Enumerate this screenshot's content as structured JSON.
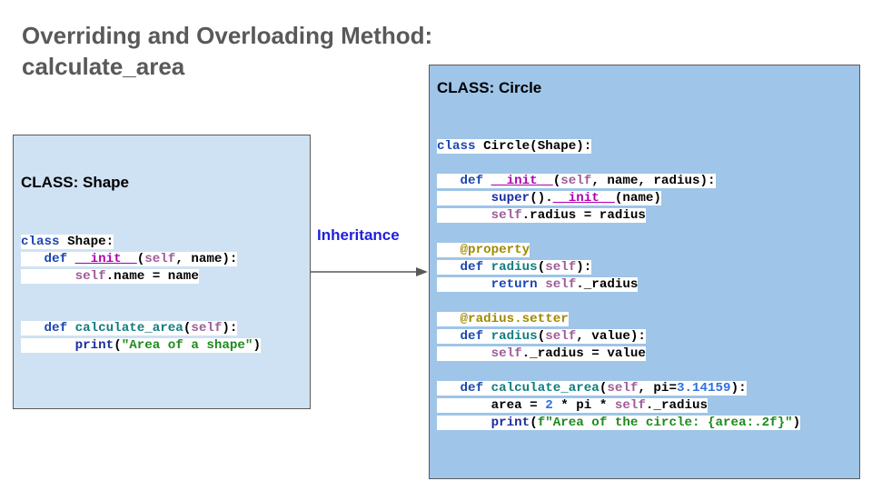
{
  "title": {
    "line1": "Overriding and Overloading Method:",
    "line2": "calculate_area"
  },
  "relationship": {
    "label": "Inheritance",
    "from": "CLASS: Shape",
    "to": "CLASS: Circle"
  },
  "shape_class": {
    "heading": "CLASS: Shape",
    "code": {
      "l1_kw": "class",
      "l1_rest": " Shape:",
      "l2_kw": "def",
      "l2_magic": "__init__",
      "l2_open": "(",
      "l2_self": "self",
      "l2_rest": ", name):",
      "l3_self": "self",
      "l3_rest": ".name = name",
      "l4_kw": "def",
      "l4_fn": "calculate_area",
      "l4_open": "(",
      "l4_self": "self",
      "l4_rest": "):",
      "l5_fn": "print",
      "l5_open": "(",
      "l5_str": "\"Area of a shape\"",
      "l5_close": ")"
    }
  },
  "circle_class": {
    "heading": "CLASS: Circle",
    "code": {
      "l1_kw": "class",
      "l1_rest": " Circle(Shape):",
      "l2_kw": "def",
      "l2_magic": "__init__",
      "l2_open": "(",
      "l2_self": "self",
      "l2_rest": ", name, radius):",
      "l3_fn": "super",
      "l3_mid": "().",
      "l3_magic": "__init__",
      "l3_rest": "(name)",
      "l4_self": "self",
      "l4_rest": ".radius = radius",
      "l5_dec": "@property",
      "l6_kw": "def",
      "l6_fn": "radius",
      "l6_open": "(",
      "l6_self": "self",
      "l6_rest": "):",
      "l7_kw": "return",
      "l7_self": "self",
      "l7_rest": "._radius",
      "l8_dec": "@radius.setter",
      "l9_kw": "def",
      "l9_fn": "radius",
      "l9_open": "(",
      "l9_self": "self",
      "l9_rest": ", value):",
      "l10_self": "self",
      "l10_rest": "._radius = value",
      "l11_kw": "def",
      "l11_fn": "calculate_area",
      "l11_open": "(",
      "l11_self": "self",
      "l11_mid": ", pi=",
      "l11_num": "3.14159",
      "l11_rest": "):",
      "l12_a": "area = ",
      "l12_num": "2",
      "l12_b": " * pi * ",
      "l12_self": "self",
      "l12_rest": "._radius",
      "l13_fn": "print",
      "l13_open": "(",
      "l13_str": "f\"Area of the circle: ",
      "l13_brace": "{area:.2f}",
      "l13_end": "\"",
      "l13_close": ")"
    }
  }
}
